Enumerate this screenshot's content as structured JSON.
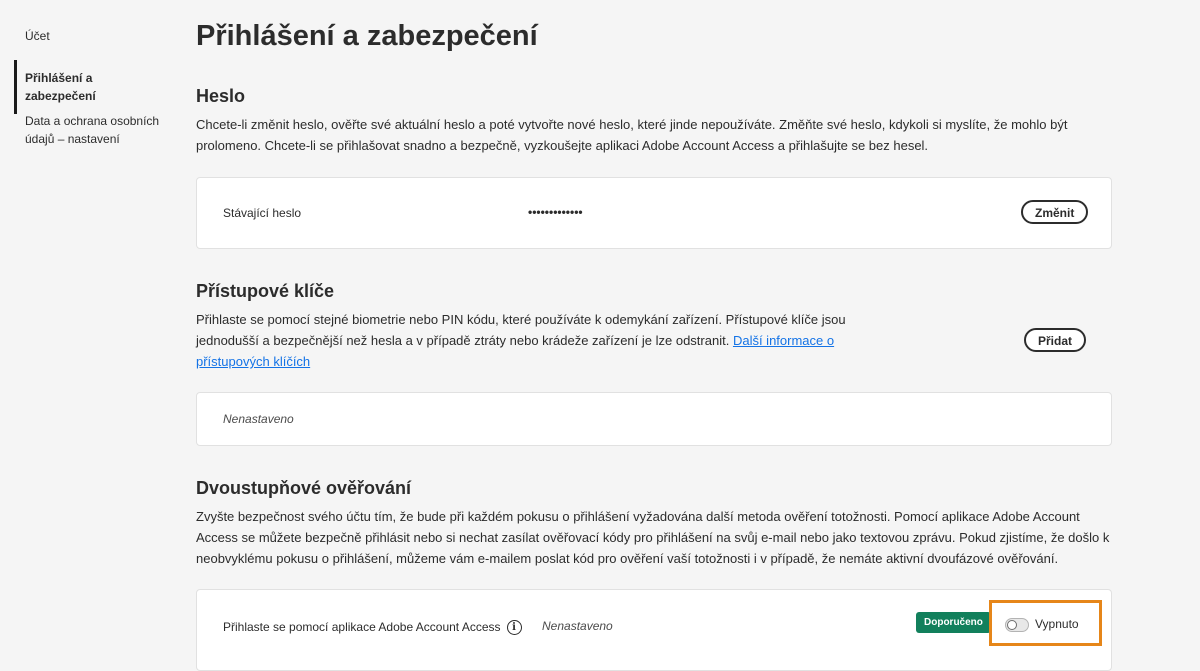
{
  "sidebar": {
    "items": [
      {
        "label": "Účet"
      },
      {
        "label": "Přihlášení a zabezpečení"
      },
      {
        "label": "Data a ochrana osobních údajů – nastavení"
      }
    ]
  },
  "page": {
    "title": "Přihlášení a zabezpečení"
  },
  "password": {
    "title": "Heslo",
    "description": "Chcete-li změnit heslo, ověřte své aktuální heslo a poté vytvořte nové heslo, které jinde nepoužíváte. Změňte své heslo, kdykoli si myslíte, že mohlo být prolomeno. Chcete-li se přihlašovat snadno a bezpečně, vyzkoušejte aplikaci Adobe Account Access a přihlašujte se bez hesel.",
    "current_label": "Stávající heslo",
    "masked_value": "•••••••••••••",
    "change_button": "Změnit"
  },
  "passkeys": {
    "title": "Přístupové klíče",
    "description": "Přihlaste se pomocí stejné biometrie nebo PIN kódu, které používáte k odemykání zařízení. Přístupové klíče jsou jednodušší a bezpečnější než hesla a v případě ztráty nebo krádeže zařízení je lze odstranit.",
    "link_text": "Další informace o přístupových klíčích",
    "add_button": "Přidat",
    "status": "Nenastaveno"
  },
  "two_step": {
    "title": "Dvoustupňové ověřování",
    "description": "Zvyšte bezpečnost svého účtu tím, že bude při každém pokusu o přihlášení vyžadována další metoda ověření totožnosti. Pomocí aplikace Adobe Account Access se můžete bezpečně přihlásit nebo si nechat zasílat ověřovací kódy pro přihlášení na svůj e-mail nebo jako textovou zprávu. Pokud zjistíme, že došlo k neobvyklému pokusu o přihlášení, můžeme vám e-mailem poslat kód pro ověření vaší totožnosti i v případě, že nemáte aktivní dvoufázové ověřování.",
    "app_label": "Přihlaste se pomocí aplikace Adobe Account Access",
    "info_glyph": "i",
    "status": "Nenastaveno",
    "badge": "Doporučeno",
    "toggle_label": "Vypnuto",
    "toggle_on": false
  },
  "colors": {
    "badge": "#12805c",
    "highlight": "#e68619",
    "link": "#1473e6"
  },
  "icons": [
    "info-icon",
    "toggle-switch"
  ]
}
